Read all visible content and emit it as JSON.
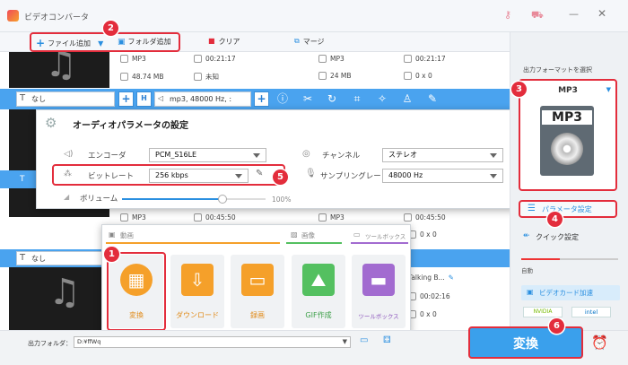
{
  "app": {
    "title": "ビデオコンバータ",
    "logo_icon": "app-logo-icon",
    "accent": "#2a8fe0",
    "highlight": "#e32d3c"
  },
  "toolbar": {
    "add_file": "ファイル追加",
    "add_folder": "フォルダ追加",
    "clear": "クリア",
    "merge": "マージ"
  },
  "files": [
    {
      "format": "MP3",
      "duration": "00:21:17",
      "size": "48.74 MB",
      "resolution": "未知",
      "out_format": "MP3",
      "out_duration": "00:21:17",
      "out_size": "24 MB",
      "out_resolution": "0 x 0"
    },
    {
      "format": "MP3",
      "duration": "00:45:50",
      "size": "",
      "resolution": "",
      "out_format": "MP3",
      "out_duration": "00:45:50",
      "out_size": "",
      "out_resolution": "0 x 0"
    },
    {
      "format": "",
      "duration": "",
      "size": "",
      "resolution": "",
      "out_format": "",
      "out_duration": "00:02:16",
      "out_size": "",
      "out_resolution": "0 x 0",
      "name": "Talking B..."
    }
  ],
  "row_bar": {
    "subtitle": "なし",
    "audio": "mp3, 48000 Hz, :",
    "subtitle_bottom": "なし"
  },
  "audio_dialog": {
    "title": "オーディオパラメータの設定",
    "encoder_label": "エンコーダ",
    "encoder_value": "PCM_S16LE",
    "channel_label": "チャンネル",
    "channel_value": "ステレオ",
    "bitrate_label": "ビットレート",
    "bitrate_value": "256 kbps",
    "samplerate_label": "サンプリングレート",
    "samplerate_value": "48000 Hz",
    "volume_label": "ボリューム",
    "volume_value": "100%",
    "volume_level": 0.7
  },
  "tools_popup": {
    "tab_video": "動画",
    "tab_image": "画像",
    "tab_toolbox": "ツールボックス",
    "tools": [
      {
        "label": "変換",
        "color": "#f5a02a",
        "icon": "film-icon"
      },
      {
        "label": "ダウンロード",
        "color": "#f5a02a",
        "icon": "download-icon"
      },
      {
        "label": "録画",
        "color": "#f5a02a",
        "icon": "screen-record-icon"
      },
      {
        "label": "GIF作成",
        "color": "#54c060",
        "icon": "gif-image-icon"
      },
      {
        "label": "ツールボックス",
        "color": "#a26bd0",
        "icon": "toolbox-icon"
      }
    ]
  },
  "right_panel": {
    "output_format_label": "出力フォーマットを選択",
    "format": "MP3",
    "param_settings": "パラメータ設定",
    "quick_settings": "クイック設定",
    "auto": "自動",
    "gpu_accel": "ビデオカード加速",
    "nvidia": "NVIDIA",
    "intel": "intel"
  },
  "bottom": {
    "output_folder_label": "出力フォルダ：",
    "output_folder_value": "D:¥ffWq",
    "convert_button": "変換"
  },
  "badges": [
    "1",
    "2",
    "3",
    "4",
    "5",
    "6"
  ]
}
